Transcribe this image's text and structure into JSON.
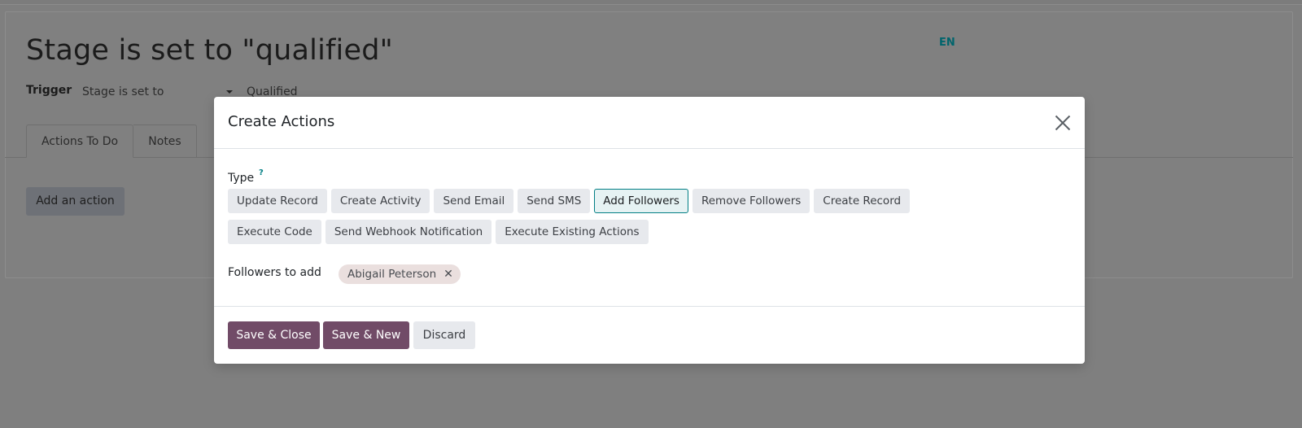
{
  "background": {
    "record_title": "Stage is set to \"qualified\"",
    "language": "EN",
    "trigger_label": "Trigger",
    "trigger_value": "Stage is set to",
    "stage_value": "Qualified",
    "tabs": [
      {
        "label": "Actions To Do"
      },
      {
        "label": "Notes"
      }
    ],
    "add_action_label": "Add an action"
  },
  "modal": {
    "title": "Create Actions",
    "type_label": "Type",
    "type_help": "?",
    "type_options": [
      {
        "label": "Update Record",
        "active": false
      },
      {
        "label": "Create Activity",
        "active": false
      },
      {
        "label": "Send Email",
        "active": false
      },
      {
        "label": "Send SMS",
        "active": false
      },
      {
        "label": "Add Followers",
        "active": true
      },
      {
        "label": "Remove Followers",
        "active": false
      },
      {
        "label": "Create Record",
        "active": false
      },
      {
        "label": "Execute Code",
        "active": false
      },
      {
        "label": "Send Webhook Notification",
        "active": false
      },
      {
        "label": "Execute Existing Actions",
        "active": false
      }
    ],
    "followers_label": "Followers to add",
    "followers": [
      {
        "name": "Abigail Peterson",
        "remove_glyph": "✕"
      }
    ],
    "footer": {
      "save_close": "Save & Close",
      "save_new": "Save & New",
      "discard": "Discard"
    }
  },
  "colors": {
    "primary": "#714b67",
    "accent": "#017e84",
    "overlay": "#7f7f7f"
  }
}
